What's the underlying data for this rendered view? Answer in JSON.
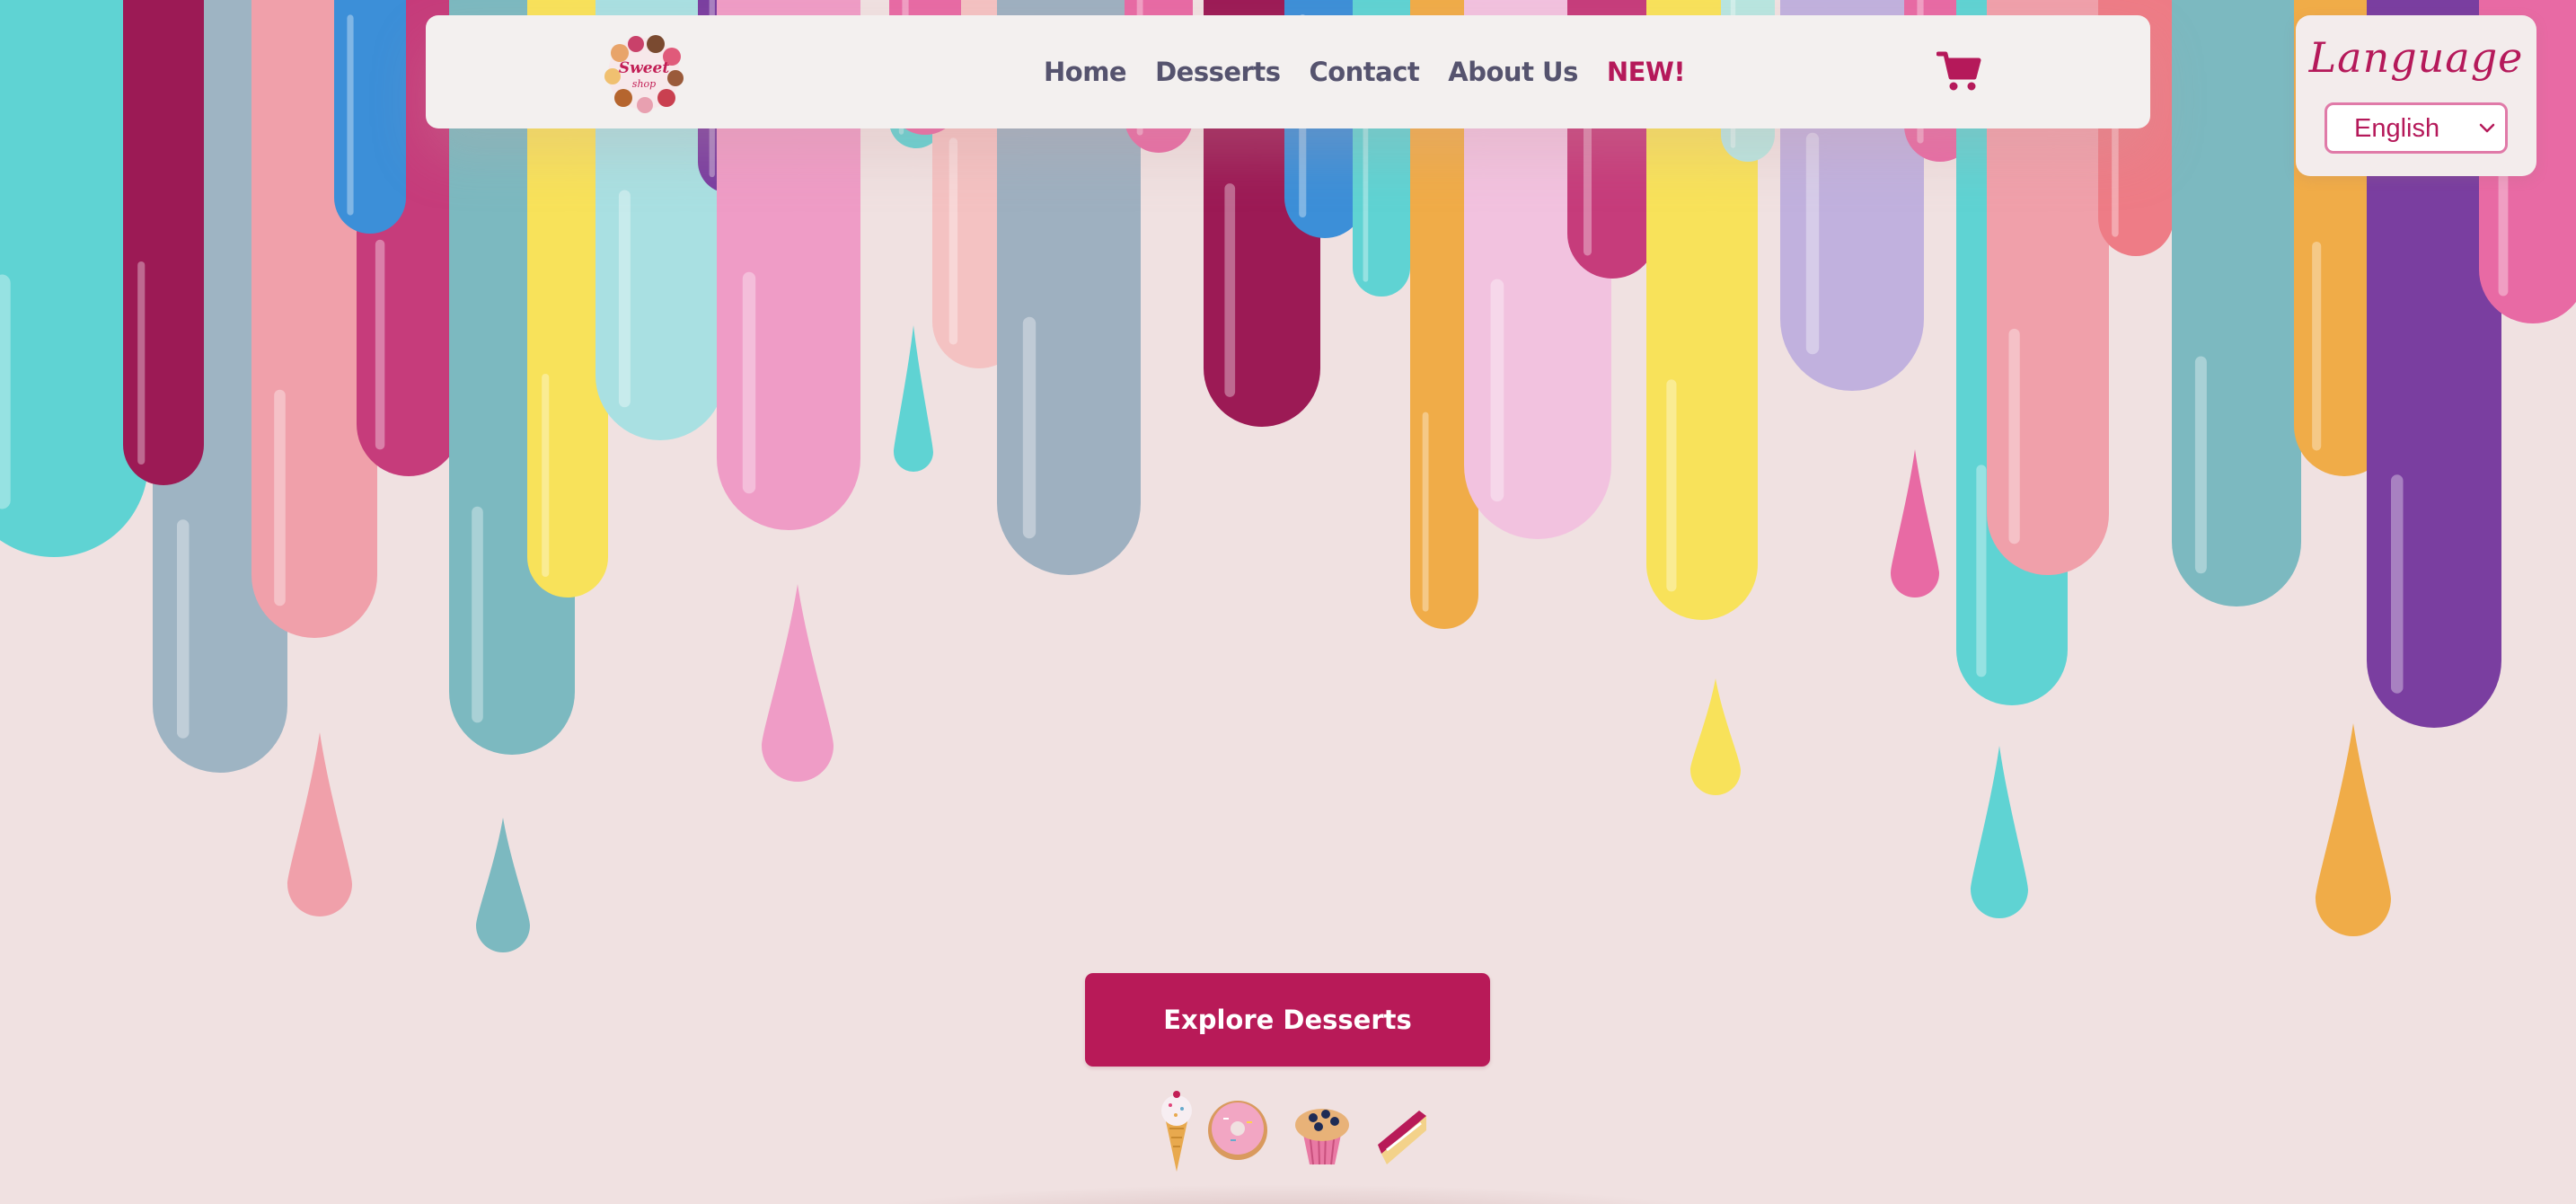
{
  "nav": {
    "logo_alt": "Sweet shop",
    "links": [
      "Home",
      "Desserts",
      "Contact",
      "About Us",
      "NEW!"
    ]
  },
  "language": {
    "title": "Language",
    "selected": "English"
  },
  "hero": {
    "cta_label": "Explore Desserts"
  },
  "colors": {
    "accent": "#b81a58",
    "nav_text": "#55536e",
    "background": "#f0e1e1",
    "nav_bg": "#f3f0ef"
  },
  "icons": {
    "cart": "cart-icon",
    "chevron": "chevron-down-icon",
    "sweets": [
      "ice-cream-icon",
      "donut-icon",
      "cupcake-icon",
      "cake-slice-icon"
    ]
  }
}
